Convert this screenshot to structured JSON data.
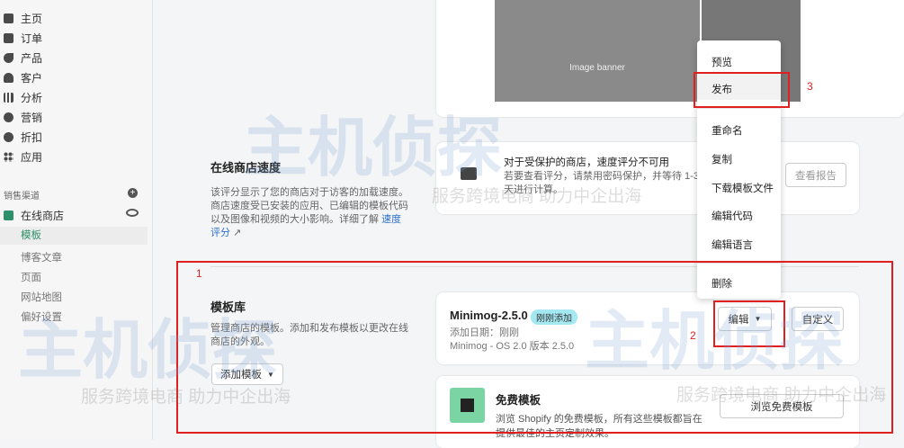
{
  "sidebar": {
    "items": [
      {
        "label": "主页"
      },
      {
        "label": "订单"
      },
      {
        "label": "产品"
      },
      {
        "label": "客户"
      },
      {
        "label": "分析"
      },
      {
        "label": "营销"
      },
      {
        "label": "折扣"
      },
      {
        "label": "应用"
      }
    ],
    "channels_label": "销售渠道",
    "online_store": "在线商店",
    "sub_items": [
      "模板",
      "博客文章",
      "页面",
      "网站地图",
      "偏好设置"
    ]
  },
  "preview": {
    "banner_text": "Image banner"
  },
  "speed": {
    "title": "在线商店速度",
    "desc": "该评分显示了您的商店对于访客的加载速度。商店速度受已安装的应用、已编辑的模板代码以及图像和视频的大小影响。详细了解",
    "link": "速度评分",
    "notice_title": "对于受保护的商店，速度评分不可用",
    "notice_body": "若要查看评分，请禁用密码保护，并等待 1-3 天进行计算。",
    "report_button": "查看报告"
  },
  "library": {
    "title": "模板库",
    "desc": "管理商店的模板。添加和发布模板以更改在线商店的外观。",
    "add_button": "添加模板",
    "theme": {
      "name": "Minimog-2.5.0",
      "badge": "刚刚添加",
      "added": "添加日期：刚刚",
      "version": "Minimog - OS 2.0 版本 2.5.0",
      "edit_button": "编辑",
      "customize_button": "自定义"
    },
    "free": {
      "title": "免费模板",
      "desc": "浏览 Shopify 的免费模板，所有这些模板都旨在提供最佳的主页定制效果。",
      "button": "浏览免费模板"
    }
  },
  "menu": {
    "items": [
      "预览",
      "发布",
      "重命名",
      "复制",
      "下载模板文件",
      "编辑代码",
      "编辑语言",
      "删除"
    ]
  },
  "annotations": [
    "1",
    "2",
    "3"
  ],
  "watermark": {
    "brand": "主机侦探",
    "slogan": "服务跨境电商 助力中企出海"
  },
  "colors": {
    "accent": "#2e8f6b",
    "annotation": "#e02020",
    "badge": "#a4e8f2"
  }
}
